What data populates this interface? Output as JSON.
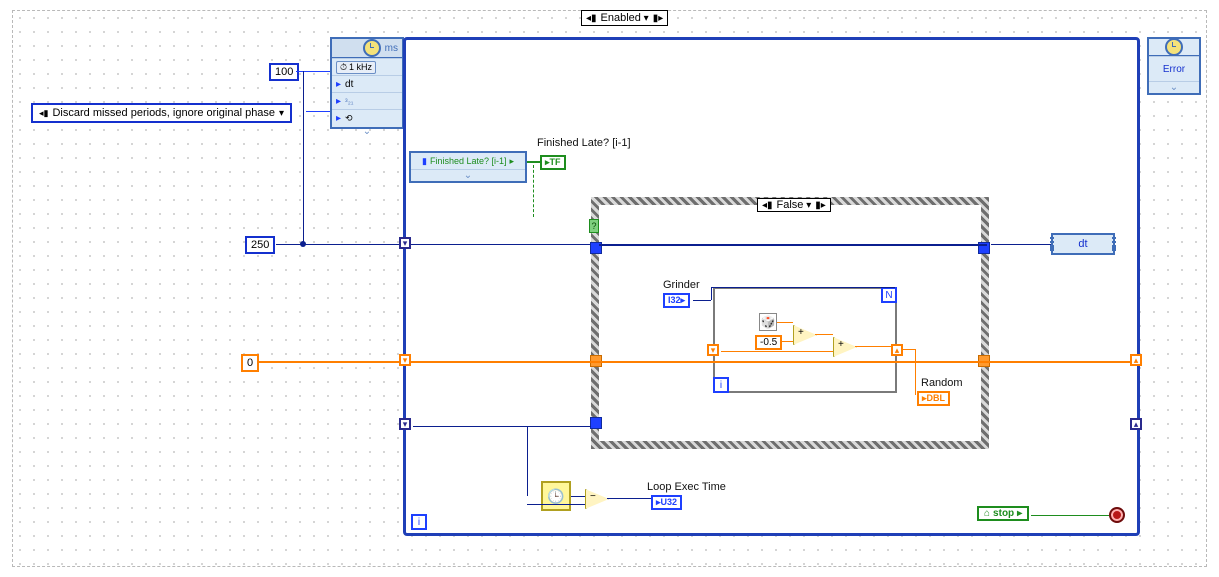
{
  "diagram": {
    "enabled_selector": "Enabled",
    "constants": {
      "period_ms_100": "100",
      "const_250": "250",
      "const_0": "0",
      "neg_half": "-0.5"
    },
    "discard_mode": "Discard missed periods, ignore original phase",
    "timed_loop": {
      "unit": "ms",
      "clock_source": "1 kHz",
      "dt_label": "dt",
      "right_error": "Error",
      "right_dt": "dt",
      "finished_late_label": "Finished Late? [i-1]",
      "finished_late_tf": "TF"
    },
    "case_struct": {
      "selector_value": "False"
    },
    "for_loop": {
      "n_terminal": "N",
      "i_terminal": "i",
      "grinder_label": "Grinder",
      "grinder_type": "I32",
      "random_label": "Random",
      "random_type": "DBL"
    },
    "loop_exec_time": {
      "label": "Loop Exec Time",
      "type": "U32"
    },
    "stop_label": "stop",
    "iteration_terminal": "i"
  }
}
